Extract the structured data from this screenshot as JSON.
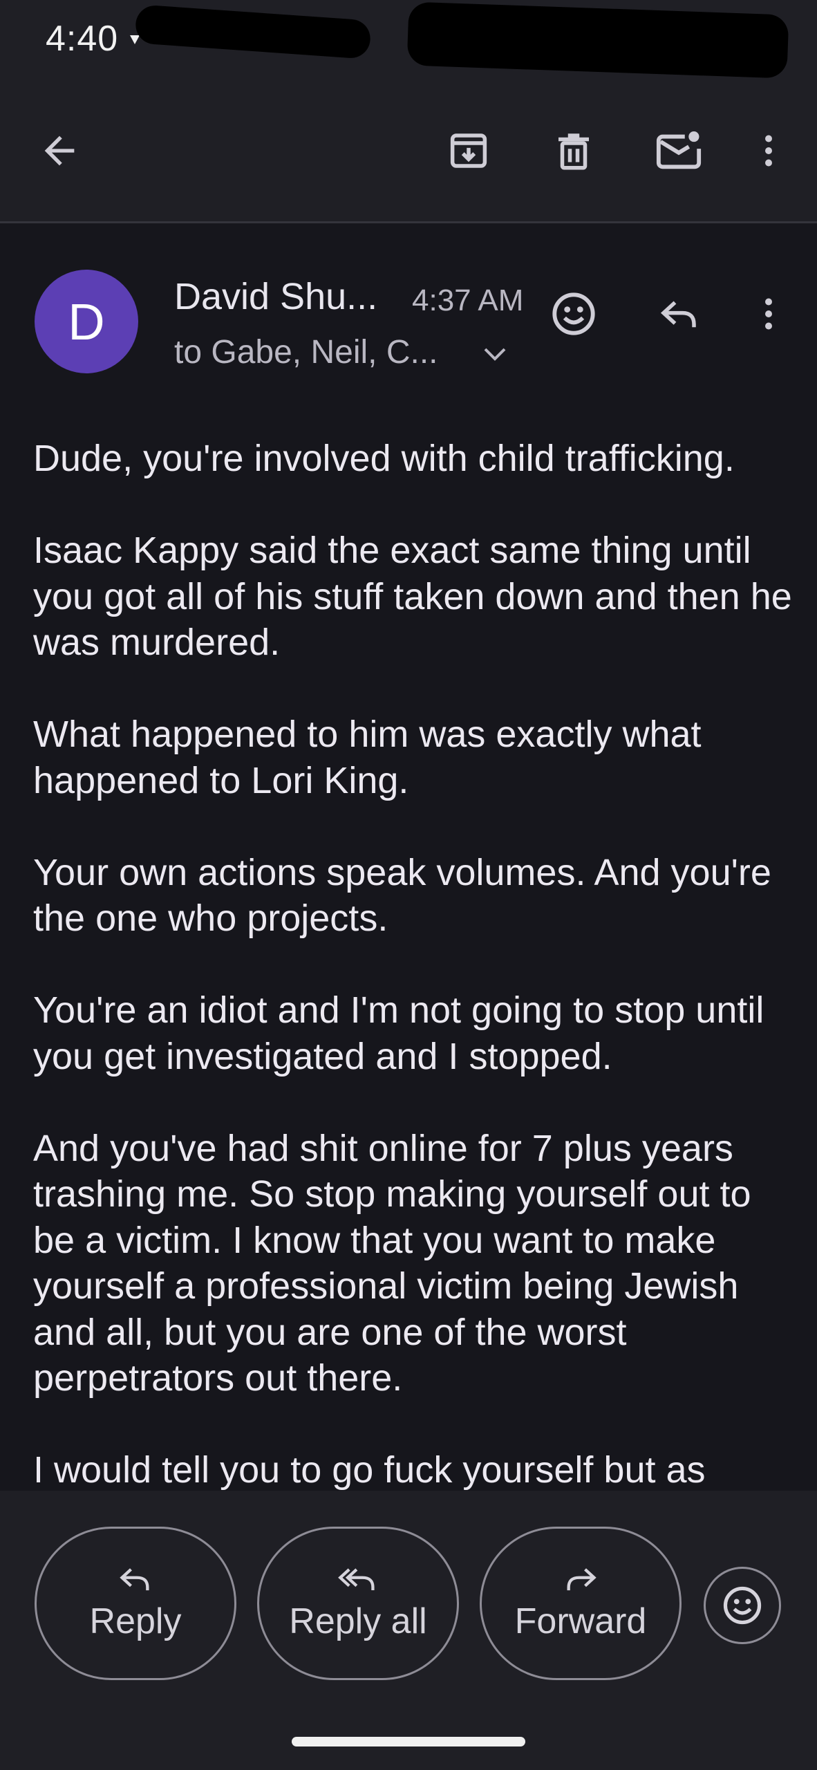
{
  "status_bar": {
    "time": "4:40"
  },
  "toolbar": {
    "icons": [
      "back-arrow-icon",
      "archive-icon",
      "delete-icon",
      "mark-unread-icon",
      "more-vert-icon"
    ]
  },
  "email": {
    "avatar_letter": "D",
    "sender": "David Shu...",
    "time": "4:37 AM",
    "recipients": "to Gabe, Neil, C...",
    "paragraphs": [
      "Dude, you're involved with child trafficking.",
      "Isaac Kappy said the exact same thing until you got all of his stuff taken down and then he was murdered.",
      "What happened to him was exactly what happened to Lori King.",
      "Your own actions speak volumes. And you're the one who projects.",
      "You're an idiot and I'm not going to stop until you get investigated and I stopped.",
      "And you've had shit online for 7 plus years trashing me. So stop making yourself out to be a victim. I know that you want to make yourself a professional victim being Jewish and all, but you are one of the worst perpetrators out there.",
      "I would tell you to go fuck yourself but as"
    ]
  },
  "actions": {
    "reply": "Reply",
    "reply_all": "Reply all",
    "forward": "Forward"
  },
  "colors": {
    "avatar": "#5c3fb4",
    "background": "#16161c",
    "bar": "#1f1f25"
  }
}
